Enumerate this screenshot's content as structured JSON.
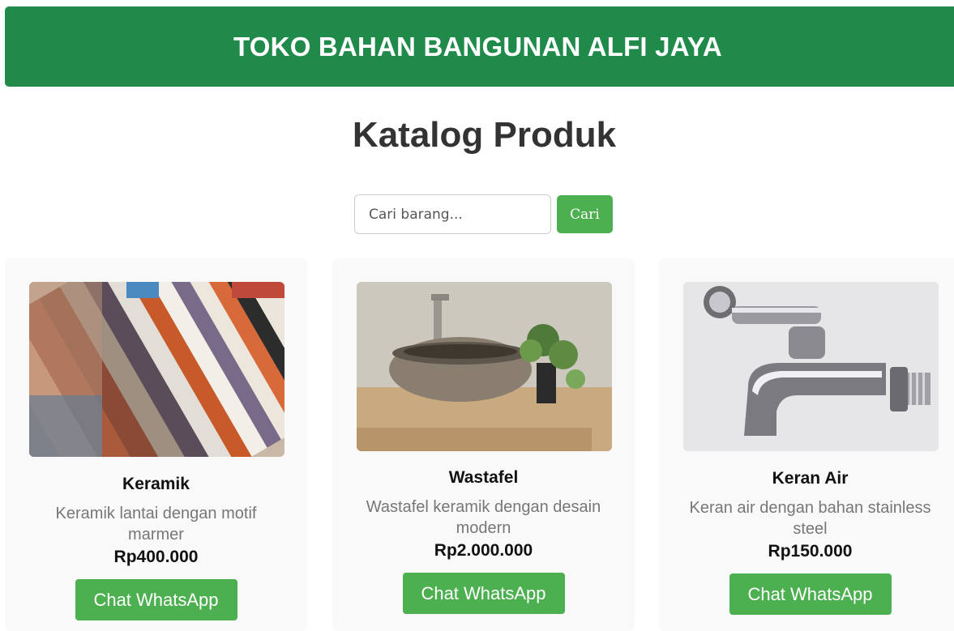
{
  "header": {
    "title": "TOKO BAHAN BANGUNAN ALFI JAYA"
  },
  "page": {
    "title": "Katalog Produk"
  },
  "search": {
    "placeholder": "Cari barang...",
    "value": "",
    "button_label": "Cari"
  },
  "products": [
    {
      "name": "Keramik",
      "description": "Keramik lantai dengan motif marmer",
      "price": "Rp400.000",
      "button_label": "Chat WhatsApp",
      "image": "ceramic-tiles-image"
    },
    {
      "name": "Wastafel",
      "description": "Wastafel keramik dengan desain modern",
      "price": "Rp2.000.000",
      "button_label": "Chat WhatsApp",
      "image": "stone-sink-image"
    },
    {
      "name": "Keran Air",
      "description": "Keran air dengan bahan stainless steel",
      "price": "Rp150.000",
      "button_label": "Chat WhatsApp",
      "image": "water-faucet-image"
    }
  ],
  "colors": {
    "header": "#1f8a4a",
    "button": "#4caf50",
    "card": "#f9f9f9"
  }
}
